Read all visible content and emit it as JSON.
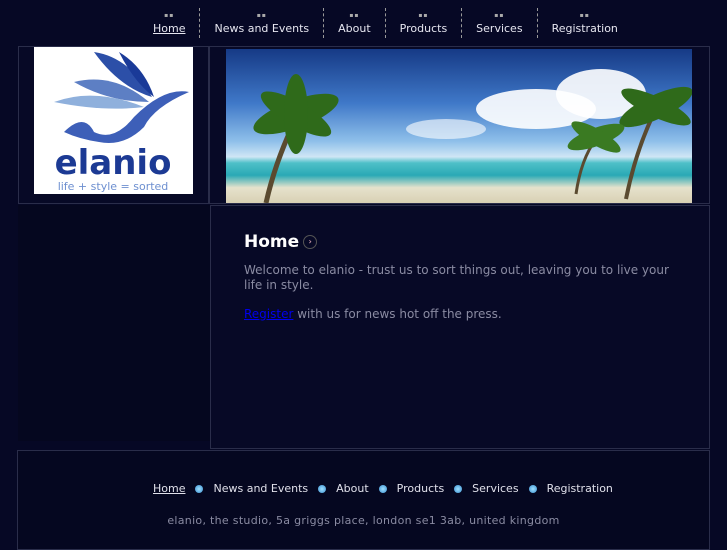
{
  "nav": {
    "items": [
      {
        "label": "Home",
        "active": true
      },
      {
        "label": "News and Events"
      },
      {
        "label": "About"
      },
      {
        "label": "Products"
      },
      {
        "label": "Services"
      },
      {
        "label": "Registration"
      }
    ]
  },
  "logo": {
    "name": "elanio",
    "tagline": "life + style = sorted"
  },
  "content": {
    "title": "Home",
    "intro": "Welcome to elanio - trust us to sort things out, leaving you to live your life in style.",
    "register_link": "Register",
    "register_rest": " with us for news hot off the press."
  },
  "footer": {
    "items": [
      "Home",
      "News and Events",
      "About",
      "Products",
      "Services",
      "Registration"
    ],
    "address": "elanio, the studio, 5a griggs place, london se1 3ab, united kingdom"
  },
  "colors": {
    "background": "#060825",
    "link": "#0000ee",
    "bullet": "#5ab4f0"
  }
}
